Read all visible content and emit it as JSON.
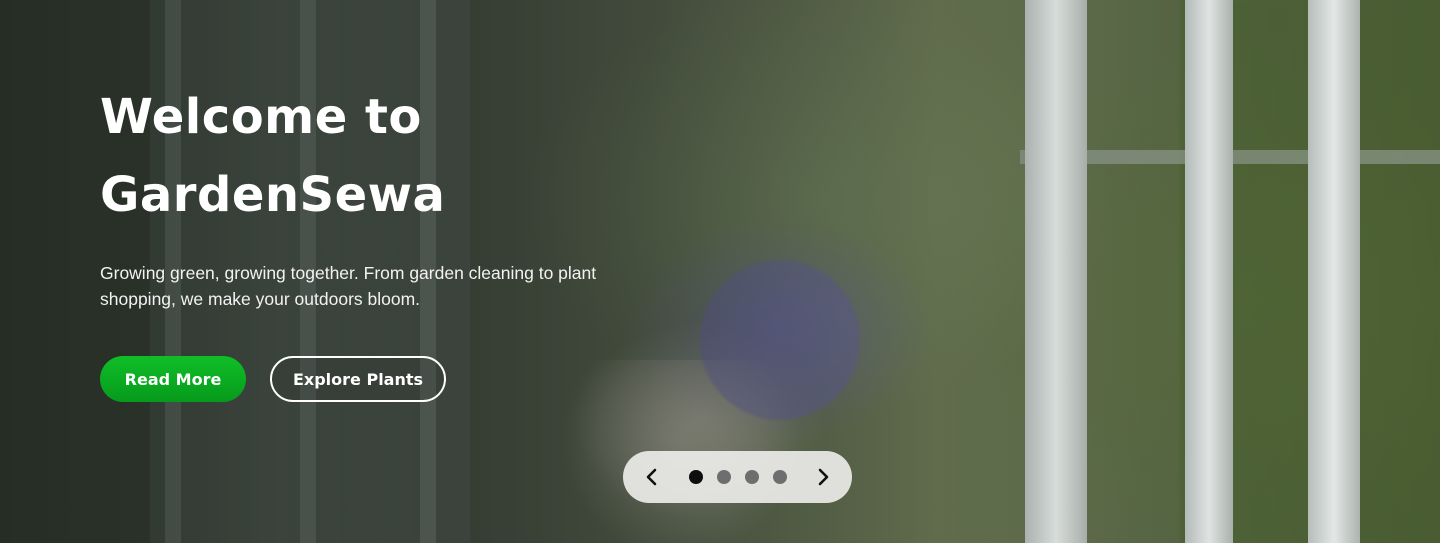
{
  "hero": {
    "title_line1": "Welcome to",
    "title_line2": "GardenSewa",
    "subtitle": "Growing green, growing together. From garden cleaning to plant shopping, we make your outdoors bloom.",
    "primary_button": "Read More",
    "secondary_button": "Explore Plants",
    "colors": {
      "primary_button": "#0aab22",
      "text": "#ffffff"
    }
  },
  "slider": {
    "prev_icon": "chevron-left-icon",
    "next_icon": "chevron-right-icon",
    "slide_count": 4,
    "active_slide": 1
  }
}
